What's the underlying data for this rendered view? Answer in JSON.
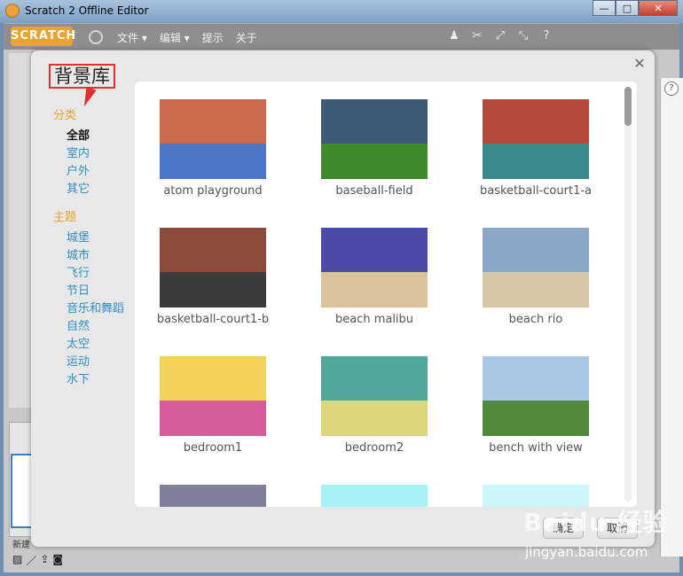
{
  "window": {
    "title": "Scratch 2 Offline Editor"
  },
  "menubar": {
    "logo": "SCRATCH",
    "items": [
      "文件 ▾",
      "编辑 ▾",
      "提示",
      "关于"
    ]
  },
  "editor": {
    "new_label": "新建"
  },
  "dialog": {
    "title": "背景库",
    "categories": {
      "heading": "分类",
      "items": [
        "全部",
        "室内",
        "户外",
        "其它"
      ]
    },
    "themes": {
      "heading": "主题",
      "items": [
        "城堡",
        "城市",
        "飞行",
        "节日",
        "音乐和舞蹈",
        "自然",
        "太空",
        "运动",
        "水下"
      ]
    },
    "backdrops": [
      {
        "label": "atom playground",
        "sky": "#c96a4a",
        "ground": "#4b76c5"
      },
      {
        "label": "baseball-field",
        "sky": "#3d5a78",
        "ground": "#3f8a2e"
      },
      {
        "label": "basketball-court1-a",
        "sky": "#b54a3a",
        "ground": "#3a8a8a"
      },
      {
        "label": "basketball-court1-b",
        "sky": "#8e4a3a",
        "ground": "#3b3b3b"
      },
      {
        "label": "beach malibu",
        "sky": "#4a4aa8",
        "ground": "#d9c39a"
      },
      {
        "label": "beach rio",
        "sky": "#8aa8c8",
        "ground": "#d7c6a3"
      },
      {
        "label": "bedroom1",
        "sky": "#f5d35a",
        "ground": "#d75c9c"
      },
      {
        "label": "bedroom2",
        "sky": "#4fa89a",
        "ground": "#dcd77a"
      },
      {
        "label": "bench with view",
        "sky": "#a8c8e6",
        "ground": "#4f8a3a"
      },
      {
        "label": "",
        "sky": "#7f7f9a",
        "ground": "#8a7a6a"
      },
      {
        "label": "",
        "sky": "#a6f2f5",
        "ground": "#ffffff"
      },
      {
        "label": "",
        "sky": "#cdf6fa",
        "ground": "#ffffff"
      }
    ],
    "ok_label": "确定",
    "cancel_label": "取消"
  },
  "watermark": {
    "brand": "Baidu 经验",
    "url": "jingyan.baidu.com"
  },
  "colors": {
    "accent": "#e8a330",
    "link": "#2d8fc6",
    "highlight": "#e03030"
  }
}
